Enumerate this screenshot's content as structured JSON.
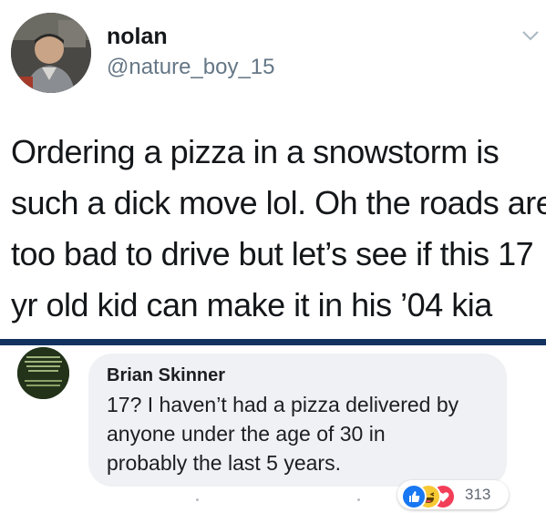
{
  "tweet": {
    "display_name": "nolan",
    "handle": "@nature_boy_15",
    "text_lines": [
      "Ordering a pizza in a snowstorm is",
      "such a dick move lol. Oh the roads are",
      "too bad to drive but let’s see if this 17",
      "yr old kid can make it in his ’04 kia"
    ],
    "menu_icon": "chevron-down-icon"
  },
  "comment": {
    "author": "Brian Skinner",
    "text_lines": [
      "17? I haven’t had a pizza delivered by",
      "anyone under the age of 30 in",
      "probably the last 5 years."
    ],
    "reactions": {
      "icons": [
        "like-icon",
        "haha-icon",
        "love-icon"
      ],
      "count": "313"
    }
  },
  "colors": {
    "divider": "#13315f",
    "handle": "#657786",
    "bubble": "#f0f1f4",
    "like": "#1877f2",
    "haha": "#f7c934",
    "love": "#f33e58"
  }
}
